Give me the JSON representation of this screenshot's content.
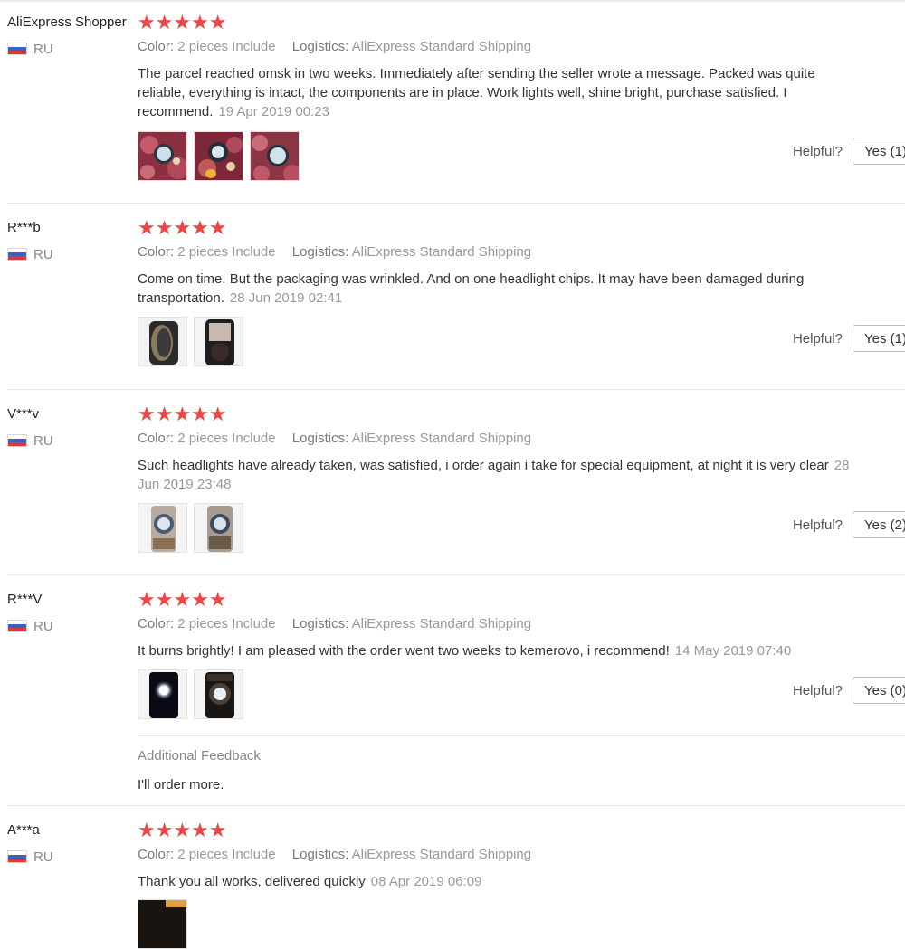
{
  "labels": {
    "color_key": "Color:",
    "logistics_key": "Logistics:",
    "helpful": "Helpful?",
    "stars": "★★★★★"
  },
  "reviews": [
    {
      "name": "AliExpress Shopper",
      "country": "RU",
      "color": "2 pieces Include",
      "logistics": "AliExpress Standard Shipping",
      "text": "The parcel reached omsk in two weeks. Immediately after sending the seller wrote a message. Packed was quite reliable, everything is intact, the components are in place. Work lights well, shine bright, purchase satisfied. I recommend.",
      "date": "19 Apr 2019 00:23",
      "yes": "Yes (1)"
    },
    {
      "name": "R***b",
      "country": "RU",
      "color": "2 pieces Include",
      "logistics": "AliExpress Standard Shipping",
      "text": "Come on time. But the packaging was wrinkled. And on one headlight chips. It may have been damaged during transportation.",
      "date": "28 Jun 2019 02:41",
      "yes": "Yes (1)"
    },
    {
      "name": "V***v",
      "country": "RU",
      "color": "2 pieces Include",
      "logistics": "AliExpress Standard Shipping",
      "text": "Such headlights have already taken, was satisfied, i order again i take for special equipment, at night it is very clear",
      "date": "28 Jun 2019 23:48",
      "yes": "Yes (2)"
    },
    {
      "name": "R***V",
      "country": "RU",
      "color": "2 pieces Include",
      "logistics": "AliExpress Standard Shipping",
      "text": "It burns brightly! I am pleased with the order went two weeks to kemerovo, i recommend!",
      "date": "14 May 2019 07:40",
      "yes": "Yes (0)",
      "feedback_title": "Additional Feedback",
      "feedback_text": "I'll order more."
    },
    {
      "name": "A***a",
      "country": "RU",
      "color": "2 pieces Include",
      "logistics": "AliExpress Standard Shipping",
      "text": "Thank you all works, delivered quickly",
      "date": "08 Apr 2019 06:09"
    }
  ]
}
